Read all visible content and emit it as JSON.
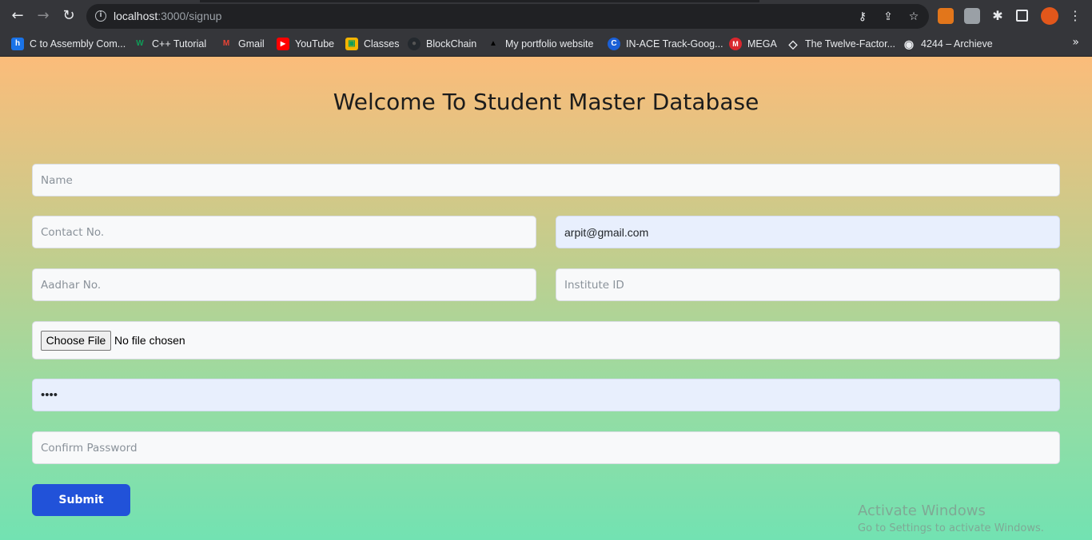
{
  "browser": {
    "url_host": "localhost",
    "url_path": ":3000/signup",
    "nav": {
      "back_icon": "←",
      "forward_icon": "→",
      "reload_icon": "↻"
    },
    "bookmarks": [
      {
        "label": "C to Assembly Com...",
        "icon": "h",
        "color": "#1a73e8"
      },
      {
        "label": "C++ Tutorial",
        "icon": "W",
        "color": "#0f9d58"
      },
      {
        "label": "Gmail",
        "icon": "M",
        "color": "#ea4335"
      },
      {
        "label": "YouTube",
        "icon": "▶",
        "color": "#ff0000"
      },
      {
        "label": "Classes",
        "icon": "▣",
        "color": "#f4b400"
      },
      {
        "label": "BlockChain",
        "icon": "●",
        "color": "#24292e"
      },
      {
        "label": "My portfolio website",
        "icon": "▲",
        "color": "#000000"
      },
      {
        "label": "IN-ACE Track-Goog...",
        "icon": "C",
        "color": "#1a5fd6"
      },
      {
        "label": "MEGA",
        "icon": "M",
        "color": "#d9272e"
      },
      {
        "label": "The Twelve-Factor...",
        "icon": "◇",
        "color": "#35363a"
      },
      {
        "label": "4244 – Archieve",
        "icon": "◉",
        "color": "#35363a"
      }
    ],
    "more_icon": "»"
  },
  "page": {
    "title": "Welcome To Student Master Database",
    "form": {
      "name_placeholder": "Name",
      "contact_placeholder": "Contact No.",
      "email_value": "arpit@gmail.com",
      "aadhar_placeholder": "Aadhar No.",
      "institute_placeholder": "Institute ID",
      "file_button": "Choose File",
      "file_status": "No file chosen",
      "password_value": "••••",
      "confirm_placeholder": "Confirm Password",
      "submit_label": "Submit"
    }
  },
  "watermark": {
    "line1": "Activate Windows",
    "line2": "Go to Settings to activate Windows."
  }
}
